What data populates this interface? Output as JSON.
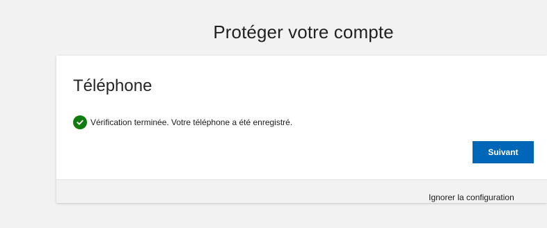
{
  "page": {
    "title": "Protéger votre compte"
  },
  "card": {
    "heading": "Téléphone",
    "status_icon": "checkmark-circle-icon",
    "status_text": "Vérification terminée. Votre téléphone a été enregistré.",
    "next_label": "Suivant"
  },
  "footer": {
    "skip_label": "Ignorer la configuration"
  },
  "colors": {
    "primary": "#0067b8",
    "success": "#107c10",
    "page_background": "#f2f2f2"
  }
}
